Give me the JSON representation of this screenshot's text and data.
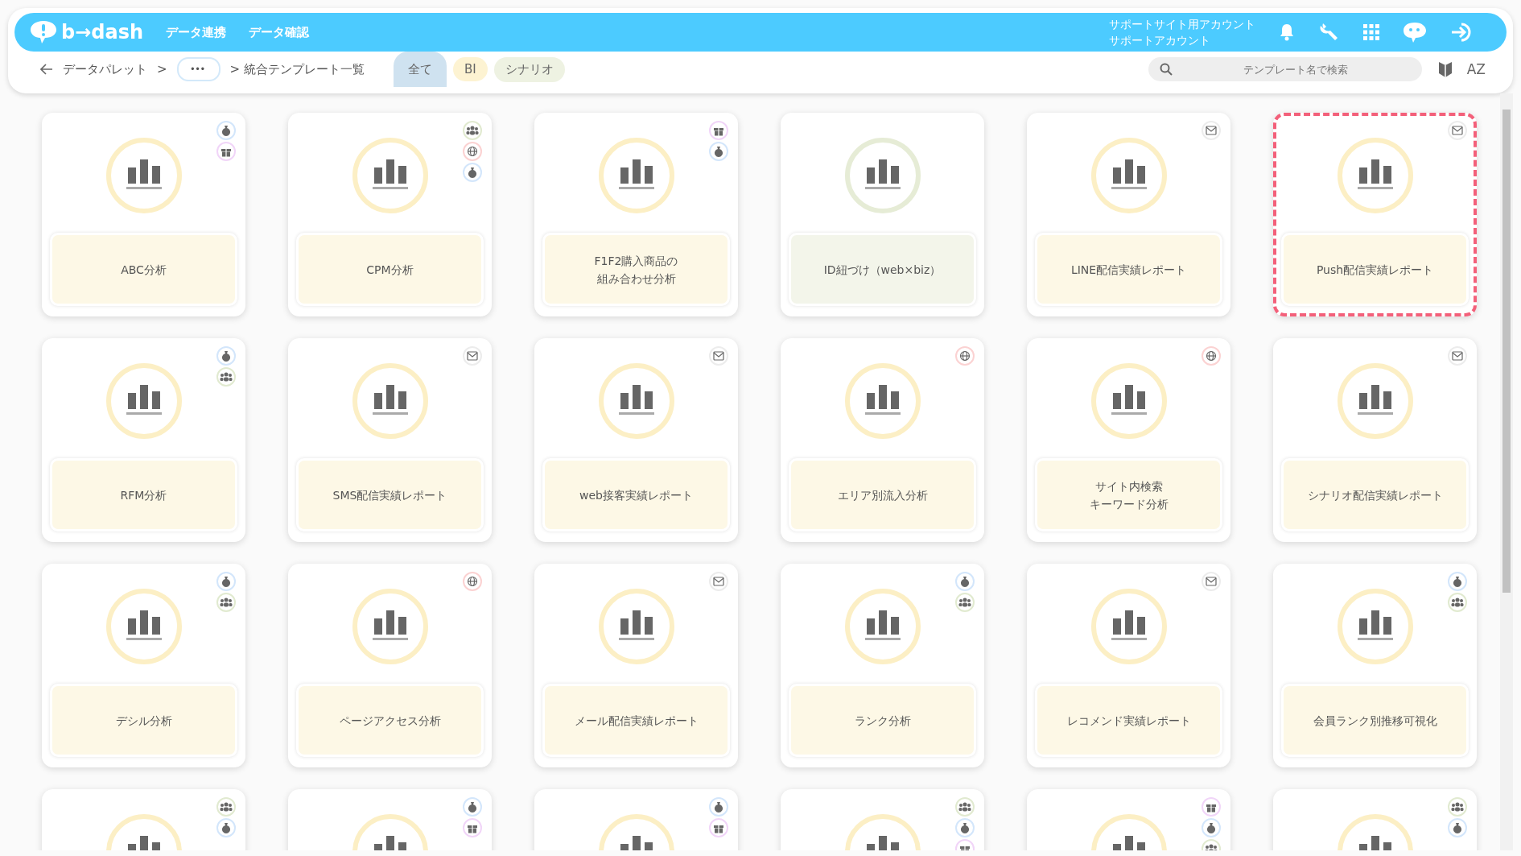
{
  "header": {
    "logo": "b→dash",
    "nav": [
      "データ連携",
      "データ確認"
    ],
    "account": [
      "サポートサイト用アカウント",
      "サポートアカウント"
    ]
  },
  "breadcrumb": {
    "items": [
      "データパレット",
      ">"
    ],
    "more": "•••",
    "current": "> 統合テンプレート一覧"
  },
  "tabs": [
    {
      "label": "全て",
      "selected": true,
      "kind": "all"
    },
    {
      "label": "BI",
      "selected": false,
      "kind": "bi"
    },
    {
      "label": "シナリオ",
      "selected": false,
      "kind": "scenario"
    }
  ],
  "search": {
    "placeholder": "テンプレート名で検索"
  },
  "sort_button": "AZ",
  "cards": [
    {
      "title": [
        "ABC分析"
      ],
      "kind": "bi",
      "selected": false,
      "tags": [
        {
          "kind": "money"
        },
        {
          "kind": "gift"
        }
      ]
    },
    {
      "title": [
        "CPM分析"
      ],
      "kind": "bi",
      "selected": false,
      "tags": [
        {
          "kind": "people"
        },
        {
          "kind": "globe"
        },
        {
          "kind": "money"
        }
      ]
    },
    {
      "title": [
        "F1F2購入商品の",
        "組み合わせ分析"
      ],
      "kind": "bi",
      "selected": false,
      "tags": [
        {
          "kind": "gift"
        },
        {
          "kind": "money"
        }
      ]
    },
    {
      "title": [
        "ID紐づけ（web×biz）"
      ],
      "kind": "scenario",
      "selected": false
    },
    {
      "title": [
        "LINE配信実績レポート"
      ],
      "kind": "bi",
      "selected": false,
      "tags": [
        {
          "kind": "mail"
        }
      ]
    },
    {
      "title": [
        "Push配信実績レポート"
      ],
      "kind": "bi",
      "selected": true,
      "tags": [
        {
          "kind": "mail"
        }
      ]
    },
    {
      "title": [
        "RFM分析"
      ],
      "kind": "bi",
      "selected": false,
      "tags": [
        {
          "kind": "money"
        },
        {
          "kind": "people"
        }
      ]
    },
    {
      "title": [
        "SMS配信実績レポート"
      ],
      "kind": "bi",
      "selected": false,
      "tags": [
        {
          "kind": "mail"
        }
      ]
    },
    {
      "title": [
        "web接客実績レポート"
      ],
      "kind": "bi",
      "selected": false,
      "tags": [
        {
          "kind": "mail"
        }
      ]
    },
    {
      "title": [
        "エリア別流入分析"
      ],
      "kind": "bi",
      "selected": false,
      "tags": [
        {
          "kind": "globe"
        }
      ]
    },
    {
      "title": [
        "サイト内検索",
        "キーワード分析"
      ],
      "kind": "bi",
      "selected": false,
      "tags": [
        {
          "kind": "globe"
        }
      ]
    },
    {
      "title": [
        "シナリオ配信実績レポート"
      ],
      "kind": "bi",
      "selected": false,
      "tags": [
        {
          "kind": "mail"
        }
      ]
    },
    {
      "title": [
        "デシル分析"
      ],
      "kind": "bi",
      "selected": false,
      "tags": [
        {
          "kind": "money"
        },
        {
          "kind": "people"
        }
      ]
    },
    {
      "title": [
        "ページアクセス分析"
      ],
      "kind": "bi",
      "selected": false,
      "tags": [
        {
          "kind": "globe"
        }
      ]
    },
    {
      "title": [
        "メール配信実績レポート"
      ],
      "kind": "bi",
      "selected": false,
      "tags": [
        {
          "kind": "mail"
        }
      ]
    },
    {
      "title": [
        "ランク分析"
      ],
      "kind": "bi",
      "selected": false,
      "tags": [
        {
          "kind": "money"
        },
        {
          "kind": "people"
        }
      ]
    },
    {
      "title": [
        "レコメンド実績レポート"
      ],
      "kind": "bi",
      "selected": false,
      "tags": [
        {
          "kind": "mail"
        }
      ]
    },
    {
      "title": [
        "会員ランク別推移可視化"
      ],
      "kind": "bi",
      "selected": false,
      "tags": [
        {
          "kind": "money"
        },
        {
          "kind": "people"
        }
      ]
    },
    {
      "kind": "bi",
      "selected": false,
      "tags": [
        {
          "kind": "people"
        },
        {
          "kind": "money"
        }
      ]
    },
    {
      "kind": "bi",
      "selected": false,
      "tags": [
        {
          "kind": "money"
        },
        {
          "kind": "gift"
        }
      ]
    },
    {
      "kind": "bi",
      "selected": false,
      "tags": [
        {
          "kind": "money"
        },
        {
          "kind": "gift"
        }
      ]
    },
    {
      "kind": "bi",
      "selected": false,
      "tags": [
        {
          "kind": "people"
        },
        {
          "kind": "money"
        },
        {
          "kind": "gift"
        }
      ]
    },
    {
      "kind": "bi",
      "selected": false,
      "tags": [
        {
          "kind": "gift"
        },
        {
          "kind": "money"
        },
        {
          "kind": "people"
        }
      ]
    },
    {
      "kind": "bi",
      "selected": false,
      "tags": [
        {
          "kind": "people"
        },
        {
          "kind": "money"
        }
      ]
    }
  ]
}
